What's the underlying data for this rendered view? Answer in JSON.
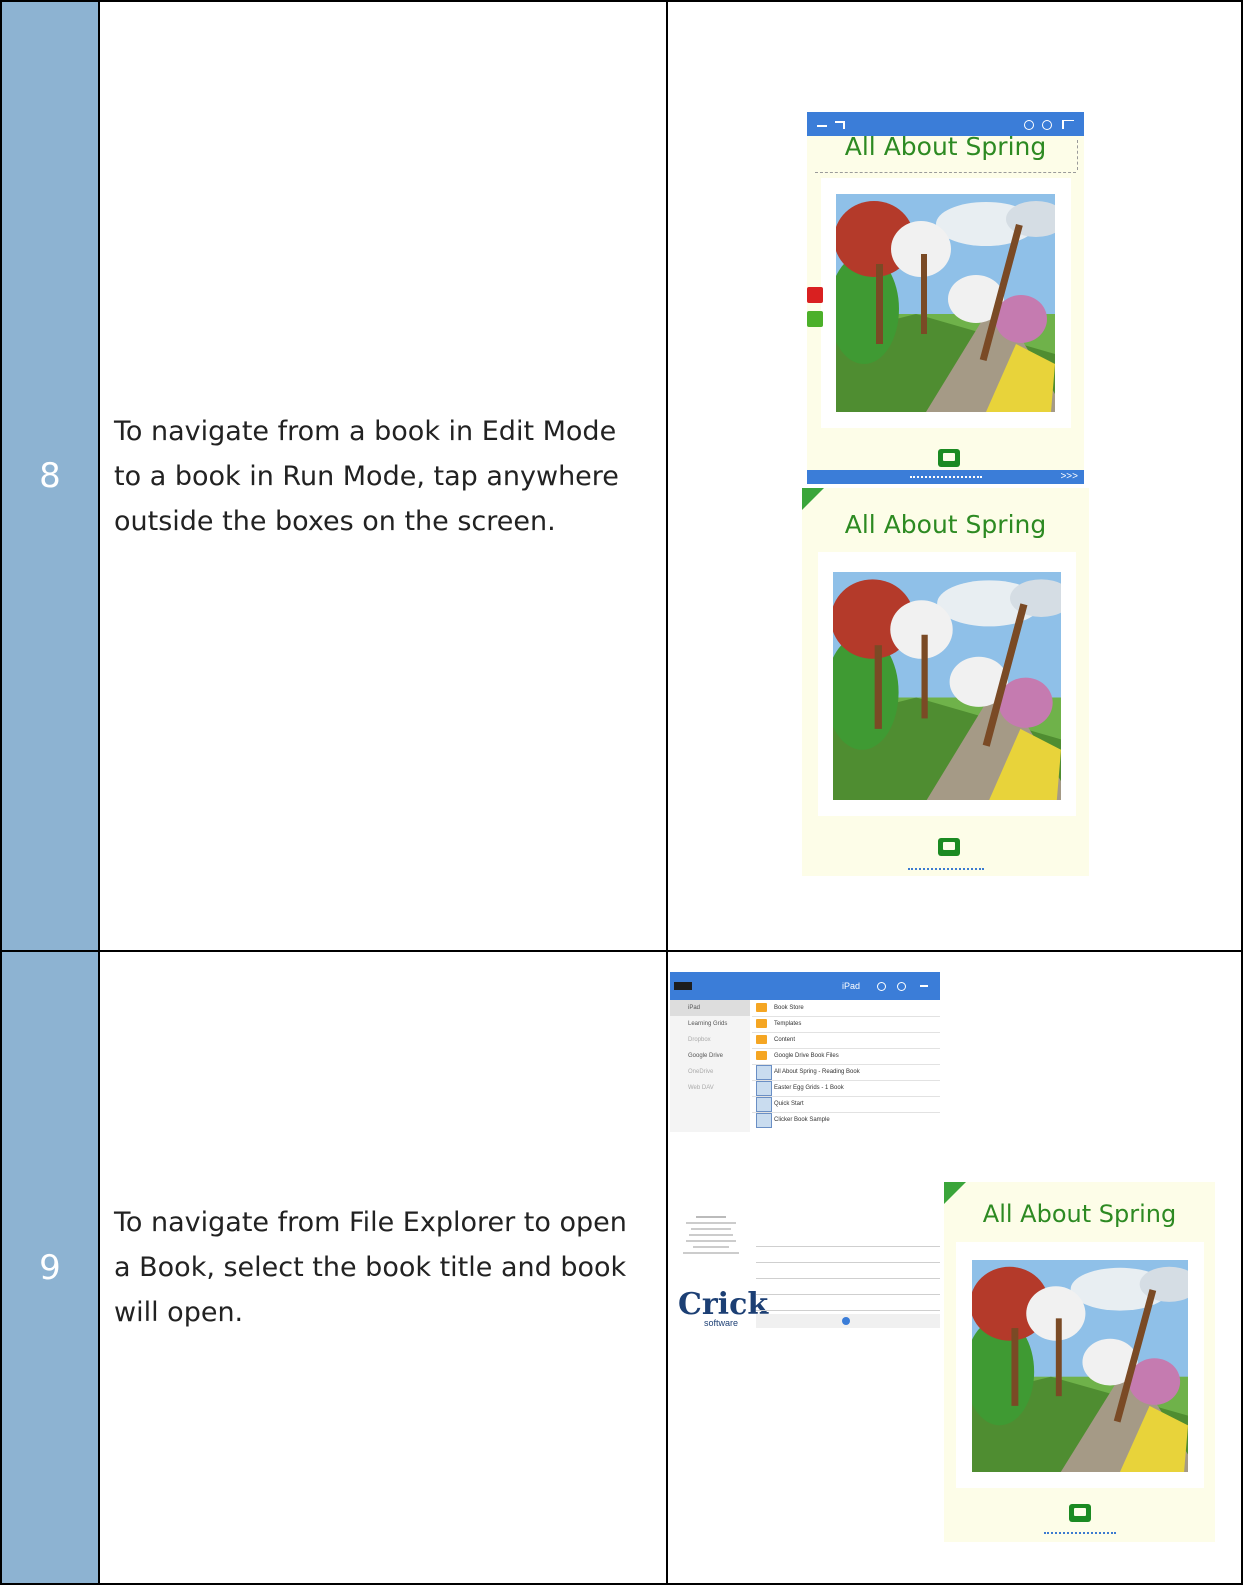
{
  "rows": [
    {
      "number": "8",
      "text": "To navigate from a book in Edit Mode to a book in Run Mode, tap anywhere outside the boxes on the screen.",
      "edit_book": {
        "title": "All About Spring",
        "next_label": ">>>"
      },
      "run_book": {
        "title": "All About Spring"
      }
    },
    {
      "number": "9",
      "text": "To navigate from File Explorer to open a Book, select the book title and book will open.",
      "file_explorer": {
        "header_title": "iPad",
        "sidebar": [
          "iPad",
          "Learning Grids",
          "Dropbox",
          "Google Drive",
          "OneDrive",
          "Web DAV"
        ],
        "items": [
          {
            "label": "Book Store",
            "kind": "folder"
          },
          {
            "label": "Templates",
            "kind": "folder"
          },
          {
            "label": "Content",
            "kind": "folder"
          },
          {
            "label": "Google Drive Book Files",
            "kind": "folder"
          },
          {
            "label": "All About Spring - Reading Book",
            "kind": "book"
          },
          {
            "label": "Easter Egg Grids - 1 Book",
            "kind": "book"
          },
          {
            "label": "Quick Start",
            "kind": "book"
          },
          {
            "label": "Clicker Book Sample",
            "kind": "book"
          }
        ]
      },
      "crick_logo": {
        "big": "Crick",
        "small": "software"
      },
      "run_book": {
        "title": "All About Spring"
      }
    }
  ],
  "colors": {
    "number_cell": "#8db3d2",
    "book_title": "#2d8a22",
    "toolbar": "#3b7dd8"
  }
}
